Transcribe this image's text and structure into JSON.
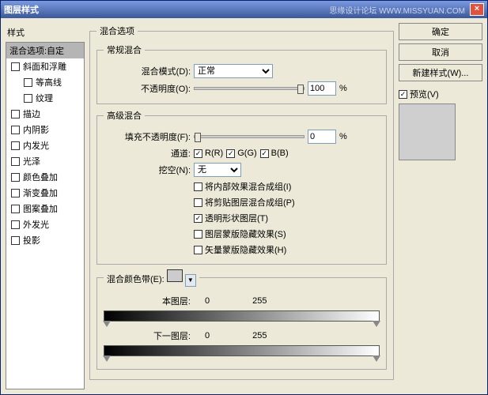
{
  "titlebar": {
    "title": "图层样式",
    "subtitle": "思缘设计论坛  WWW.MISSYUAN.COM",
    "close": "×"
  },
  "left": {
    "header": "样式",
    "selected": "混合选项:自定",
    "items": [
      "斜面和浮雕",
      "等高线",
      "纹理",
      "描边",
      "内阴影",
      "内发光",
      "光泽",
      "颜色叠加",
      "渐变叠加",
      "图案叠加",
      "外发光",
      "投影"
    ]
  },
  "mid": {
    "title": "混合选项",
    "fs1": {
      "legend": "常规混合",
      "mode_label": "混合模式(D):",
      "mode_value": "正常",
      "opacity_label": "不透明度(O):",
      "opacity_value": "100",
      "opacity_unit": "%"
    },
    "fs2": {
      "legend": "高级混合",
      "fill_label": "填充不透明度(F):",
      "fill_value": "0",
      "fill_unit": "%",
      "chan_label": "通道:",
      "r": "R(R)",
      "g": "G(G)",
      "b": "B(B)",
      "knock_label": "挖空(N):",
      "knock_value": "无",
      "o1": "将内部效果混合成组(I)",
      "o2": "将剪贴图层混合成组(P)",
      "o3": "透明形状图层(T)",
      "o4": "图层蒙版隐藏效果(S)",
      "o5": "矢量蒙版隐藏效果(H)"
    },
    "fs3": {
      "legend": "混合颜色带(E):",
      "sel": "灰色",
      "this_label": "本图层:",
      "next_label": "下一图层:",
      "v0": "0",
      "v255": "255"
    }
  },
  "right": {
    "ok": "确定",
    "cancel": "取消",
    "newstyle": "新建样式(W)...",
    "preview": "预览(V)"
  }
}
